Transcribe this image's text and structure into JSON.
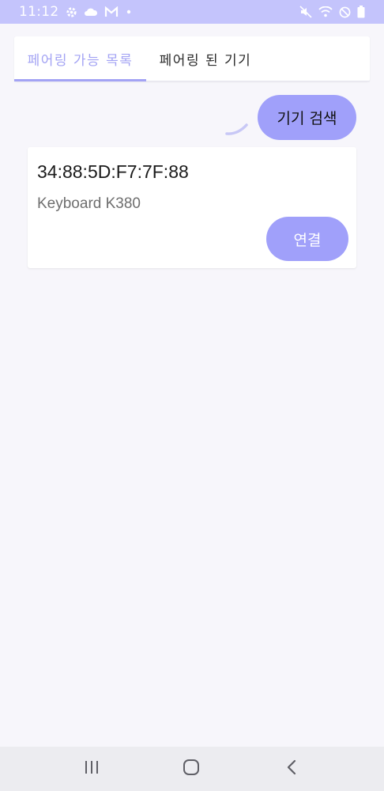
{
  "status_bar": {
    "time": "11:12",
    "icons_left": [
      "settings-icon",
      "cloud-icon",
      "gmail-icon",
      "dot-icon"
    ],
    "icons_right": [
      "mute-icon",
      "wifi-icon",
      "do-not-disturb-icon",
      "battery-icon"
    ]
  },
  "tabs": [
    {
      "label": "페어링 가능 목록",
      "selected": true
    },
    {
      "label": "페어링 된 기기",
      "selected": false
    }
  ],
  "search_button": {
    "label": "기기 검색"
  },
  "devices": [
    {
      "address": "34:88:5D:F7:7F:88",
      "name": "Keyboard K380",
      "connect_label": "연결"
    }
  ],
  "nav_bar": {
    "icons": [
      "recents-icon",
      "home-icon",
      "back-icon"
    ]
  },
  "colors": {
    "accent": "#a0a0fa",
    "status_bar": "#c4c4fc",
    "tab_selected": "#a3a3f4",
    "background": "#f7f6fb"
  }
}
